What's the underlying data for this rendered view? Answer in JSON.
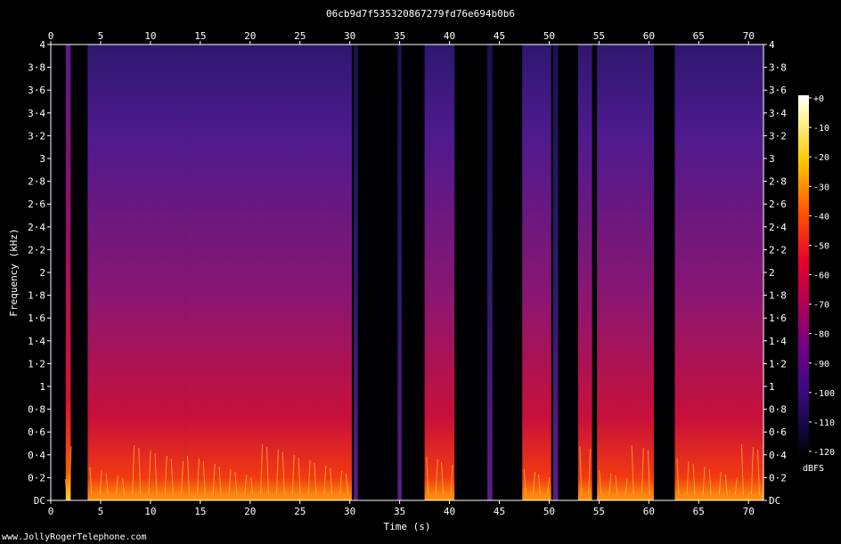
{
  "title": "06cb9d7f535320867279fd76e694b0b6",
  "watermark": "www.JollyRogerTelephone.com",
  "chart_data": {
    "type": "heatmap",
    "title": "06cb9d7f535320867279fd76e694b0b6",
    "xlabel": "Time (s)",
    "ylabel": "Frequency (kHz)",
    "xlim": [
      0,
      71.5
    ],
    "ylim": [
      0,
      4
    ],
    "x_ticks": [
      0,
      5,
      10,
      15,
      20,
      25,
      30,
      35,
      40,
      45,
      50,
      55,
      60,
      65,
      70
    ],
    "y_ticks": [
      {
        "value": 0,
        "label": "DC"
      },
      {
        "value": 0.2,
        "label": "0·2"
      },
      {
        "value": 0.4,
        "label": "0·4"
      },
      {
        "value": 0.6,
        "label": "0·6"
      },
      {
        "value": 0.8,
        "label": "0·8"
      },
      {
        "value": 1.0,
        "label": "1"
      },
      {
        "value": 1.2,
        "label": "1·2"
      },
      {
        "value": 1.4,
        "label": "1·4"
      },
      {
        "value": 1.6,
        "label": "1·6"
      },
      {
        "value": 1.8,
        "label": "1·8"
      },
      {
        "value": 2.0,
        "label": "2"
      },
      {
        "value": 2.2,
        "label": "2·2"
      },
      {
        "value": 2.4,
        "label": "2·4"
      },
      {
        "value": 2.6,
        "label": "2·6"
      },
      {
        "value": 2.8,
        "label": "2·8"
      },
      {
        "value": 3.0,
        "label": "3"
      },
      {
        "value": 3.2,
        "label": "3·2"
      },
      {
        "value": 3.4,
        "label": "3·4"
      },
      {
        "value": 3.6,
        "label": "3·6"
      },
      {
        "value": 3.8,
        "label": "3·8"
      },
      {
        "value": 4.0,
        "label": "4"
      }
    ],
    "colorbar": {
      "label": "dBFS",
      "range": [
        -120,
        0
      ],
      "ticks": [
        "+0",
        "-10",
        "-20",
        "-30",
        "-40",
        "-50",
        "-60",
        "-70",
        "-80",
        "-90",
        "-100",
        "-110",
        "-120"
      ]
    },
    "segments": [
      {
        "start": 1.5,
        "end": 2.0,
        "level": "loud"
      },
      {
        "start": 3.7,
        "end": 13.5,
        "level": "speech"
      },
      {
        "start": 13.5,
        "end": 30.2,
        "level": "speech"
      },
      {
        "start": 30.4,
        "end": 30.8,
        "level": "faint"
      },
      {
        "start": 34.8,
        "end": 35.2,
        "level": "faint"
      },
      {
        "start": 37.5,
        "end": 40.5,
        "level": "speech"
      },
      {
        "start": 43.8,
        "end": 44.3,
        "level": "faint"
      },
      {
        "start": 47.3,
        "end": 50.2,
        "level": "speech"
      },
      {
        "start": 50.4,
        "end": 50.9,
        "level": "faint"
      },
      {
        "start": 52.9,
        "end": 54.3,
        "level": "speech"
      },
      {
        "start": 54.8,
        "end": 60.5,
        "level": "speech"
      },
      {
        "start": 62.6,
        "end": 71.5,
        "level": "speech"
      }
    ]
  }
}
